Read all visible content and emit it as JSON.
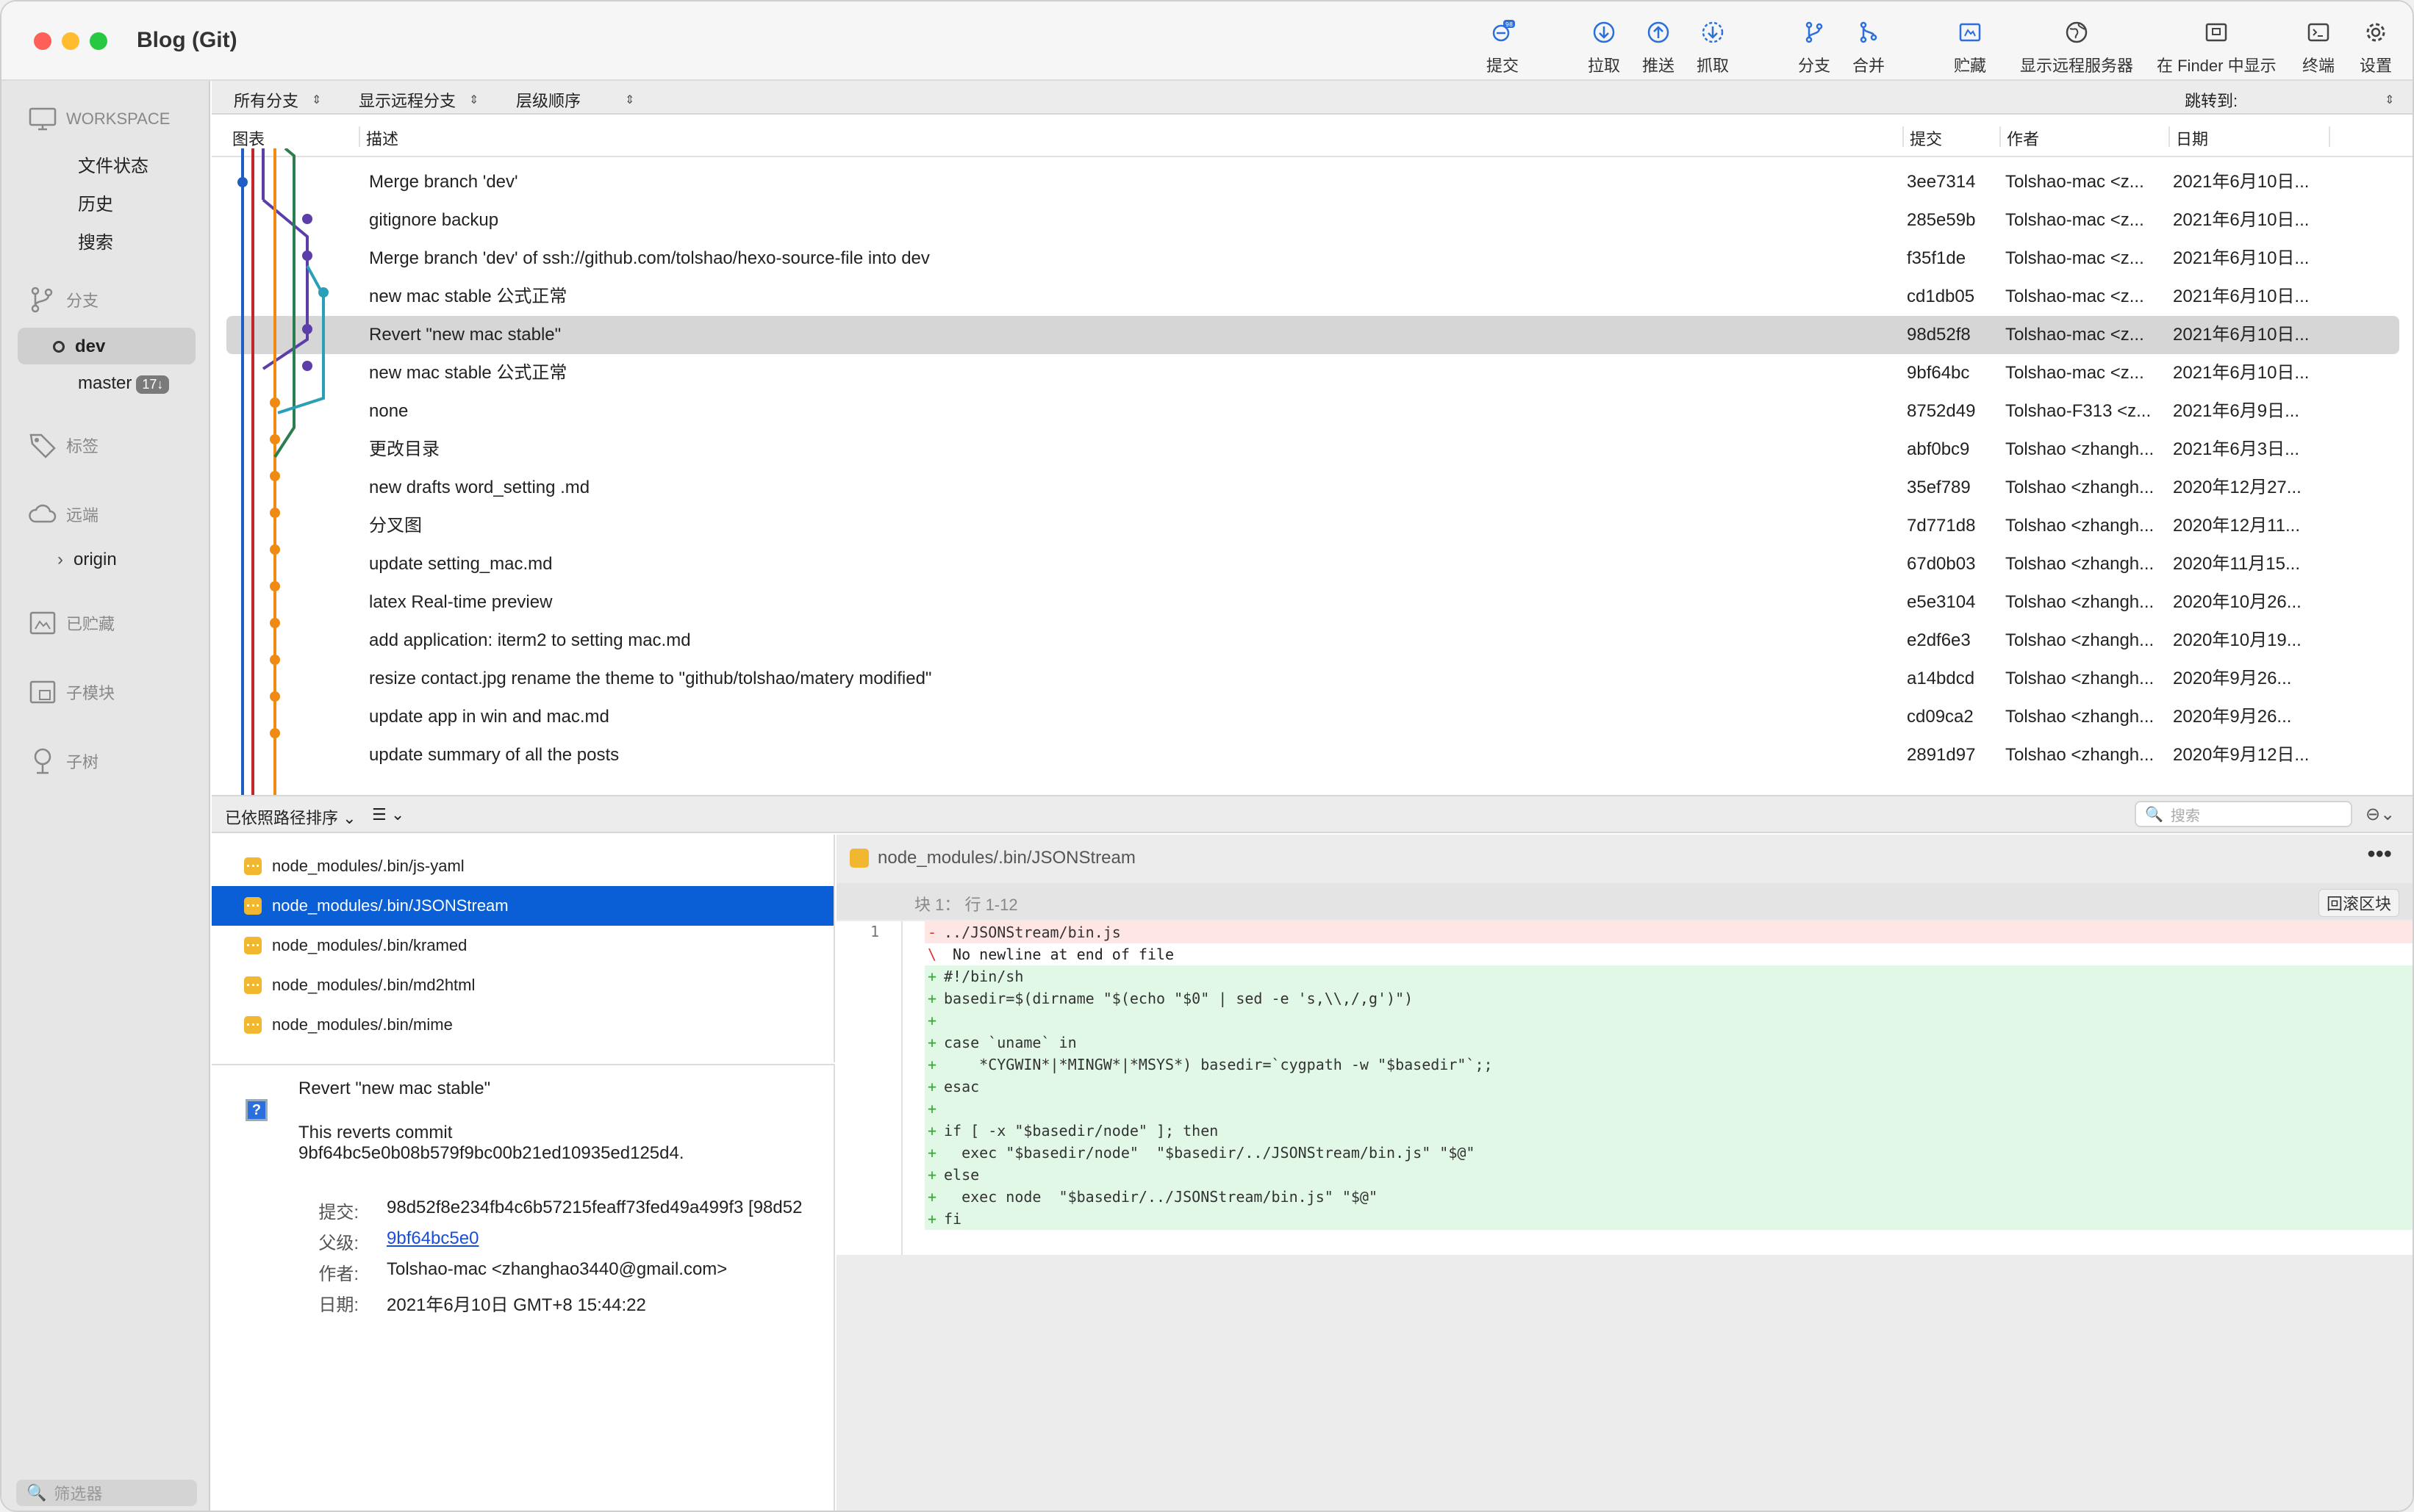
{
  "app": {
    "title": "Blog (Git)"
  },
  "toolbar": [
    {
      "label": "提交",
      "icon": "commit-icon",
      "badge": "98"
    },
    {
      "label": "拉取",
      "icon": "pull-icon"
    },
    {
      "label": "推送",
      "icon": "push-icon"
    },
    {
      "label": "抓取",
      "icon": "fetch-icon"
    },
    {
      "label": "分支",
      "icon": "branch-icon"
    },
    {
      "label": "合并",
      "icon": "merge-icon"
    },
    {
      "label": "贮藏",
      "icon": "stash-icon"
    },
    {
      "label": "显示远程服务器",
      "icon": "globe-icon"
    },
    {
      "label": "在 Finder 中显示",
      "icon": "finder-icon"
    },
    {
      "label": "终端",
      "icon": "terminal-icon"
    },
    {
      "label": "设置",
      "icon": "gear-icon"
    }
  ],
  "sidebar": {
    "workspace": "WORKSPACE",
    "workspace_items": [
      "文件状态",
      "历史",
      "搜索"
    ],
    "branches": "分支",
    "branch_items": [
      {
        "name": "dev",
        "current": true
      },
      {
        "name": "master",
        "badge": "17↓"
      }
    ],
    "tags": "标签",
    "remotes": "远端",
    "remote_items": [
      "origin"
    ],
    "stashes": "已贮藏",
    "submodules": "子模块",
    "subtrees": "子树",
    "filter_placeholder": "筛选器"
  },
  "filters": {
    "branches": "所有分支",
    "remote": "显示远程分支",
    "order": "层级顺序",
    "jump": "跳转到:"
  },
  "table": {
    "columns": {
      "graph": "图表",
      "desc": "描述",
      "commit": "提交",
      "author": "作者",
      "date": "日期"
    },
    "rows": [
      {
        "desc": "Merge branch 'dev'",
        "commit": "3ee7314",
        "author": "Tolshao-mac <z...",
        "date": "2021年6月10日..."
      },
      {
        "desc": "gitignore backup",
        "commit": "285e59b",
        "author": "Tolshao-mac <z...",
        "date": "2021年6月10日..."
      },
      {
        "desc": "Merge branch 'dev' of ssh://github.com/tolshao/hexo-source-file into dev",
        "commit": "f35f1de",
        "author": "Tolshao-mac <z...",
        "date": "2021年6月10日..."
      },
      {
        "desc": "new mac stable 公式正常",
        "commit": "cd1db05",
        "author": "Tolshao-mac <z...",
        "date": "2021年6月10日..."
      },
      {
        "desc": "Revert \"new mac stable\"",
        "commit": "98d52f8",
        "author": "Tolshao-mac <z...",
        "date": "2021年6月10日...",
        "selected": true
      },
      {
        "desc": "new mac stable 公式正常",
        "commit": "9bf64bc",
        "author": "Tolshao-mac <z...",
        "date": "2021年6月10日..."
      },
      {
        "desc": "none",
        "commit": "8752d49",
        "author": "Tolshao-F313 <z...",
        "date": "2021年6月9日..."
      },
      {
        "desc": "更改目录",
        "commit": "abf0bc9",
        "author": "Tolshao <zhangh...",
        "date": "2021年6月3日..."
      },
      {
        "desc": "new drafts word_setting .md",
        "commit": "35ef789",
        "author": "Tolshao <zhangh...",
        "date": "2020年12月27..."
      },
      {
        "desc": "分叉图",
        "commit": "7d771d8",
        "author": "Tolshao <zhangh...",
        "date": "2020年12月11..."
      },
      {
        "desc": "update setting_mac.md",
        "commit": "67d0b03",
        "author": "Tolshao <zhangh...",
        "date": "2020年11月15..."
      },
      {
        "desc": "latex Real-time preview",
        "commit": "e5e3104",
        "author": "Tolshao <zhangh...",
        "date": "2020年10月26..."
      },
      {
        "desc": "add application: iterm2 to setting mac.md",
        "commit": "e2df6e3",
        "author": "Tolshao <zhangh...",
        "date": "2020年10月19..."
      },
      {
        "desc": "resize contact.jpg rename the theme to \"github/tolshao/matery modified\"",
        "commit": "a14bdcd",
        "author": "Tolshao <zhangh...",
        "date": "2020年9月26..."
      },
      {
        "desc": "update app in win and mac.md",
        "commit": "cd09ca2",
        "author": "Tolshao <zhangh...",
        "date": "2020年9月26..."
      },
      {
        "desc": "update summary of all the posts",
        "commit": "2891d97",
        "author": "Tolshao <zhangh...",
        "date": "2020年9月12日..."
      }
    ]
  },
  "midbar": {
    "sort": "已依照路径排序",
    "search_placeholder": "搜索"
  },
  "files": [
    {
      "path": "node_modules/.bin/js-yaml"
    },
    {
      "path": "node_modules/.bin/JSONStream",
      "selected": true
    },
    {
      "path": "node_modules/.bin/kramed"
    },
    {
      "path": "node_modules/.bin/md2html"
    },
    {
      "path": "node_modules/.bin/mime"
    }
  ],
  "commit_detail": {
    "title": "Revert \"new mac stable\"",
    "body_line1": "This reverts commit",
    "body_line2": "9bf64bc5e0b08b579f9bc00b21ed10935ed125d4.",
    "commit_label": "提交:",
    "commit_value": "98d52f8e234fb4c6b57215feaff73fed49a499f3 [98d52",
    "parent_label": "父级:",
    "parent_value": "9bf64bc5e0",
    "author_label": "作者:",
    "author_value": "Tolshao-mac <zhanghao3440@gmail.com>",
    "date_label": "日期:",
    "date_value": "2021年6月10日 GMT+8 15:44:22"
  },
  "diff": {
    "file": "node_modules/.bin/JSONStream",
    "hunk": "块 1： 行 1-12",
    "rollback": "回滚区块",
    "line_number": "1",
    "lines": [
      {
        "type": "del",
        "sign": "-",
        "text": "../JSONStream/bin.js"
      },
      {
        "type": "ctx",
        "sign": "\\",
        "text": " No newline at end of file"
      },
      {
        "type": "add",
        "sign": "+",
        "text": "#!/bin/sh"
      },
      {
        "type": "add",
        "sign": "+",
        "text": "basedir=$(dirname \"$(echo \"$0\" | sed -e 's,\\\\,/,g')\")"
      },
      {
        "type": "add",
        "sign": "+",
        "text": ""
      },
      {
        "type": "add",
        "sign": "+",
        "text": "case `uname` in"
      },
      {
        "type": "add",
        "sign": "+",
        "text": "    *CYGWIN*|*MINGW*|*MSYS*) basedir=`cygpath -w \"$basedir\"`;;"
      },
      {
        "type": "add",
        "sign": "+",
        "text": "esac"
      },
      {
        "type": "add",
        "sign": "+",
        "text": ""
      },
      {
        "type": "add",
        "sign": "+",
        "text": "if [ -x \"$basedir/node\" ]; then"
      },
      {
        "type": "add",
        "sign": "+",
        "text": "  exec \"$basedir/node\"  \"$basedir/../JSONStream/bin.js\" \"$@\""
      },
      {
        "type": "add",
        "sign": "+",
        "text": "else"
      },
      {
        "type": "add",
        "sign": "+",
        "text": "  exec node  \"$basedir/../JSONStream/bin.js\" \"$@\""
      },
      {
        "type": "add",
        "sign": "+",
        "text": "fi"
      }
    ]
  },
  "colors": {
    "accent": "#0a5fd6",
    "graph_blue": "#1f5fc4",
    "graph_purple": "#5b3ea8",
    "graph_orange": "#f08a12",
    "graph_green": "#2e7d4f",
    "graph_teal": "#2a9fb8"
  }
}
